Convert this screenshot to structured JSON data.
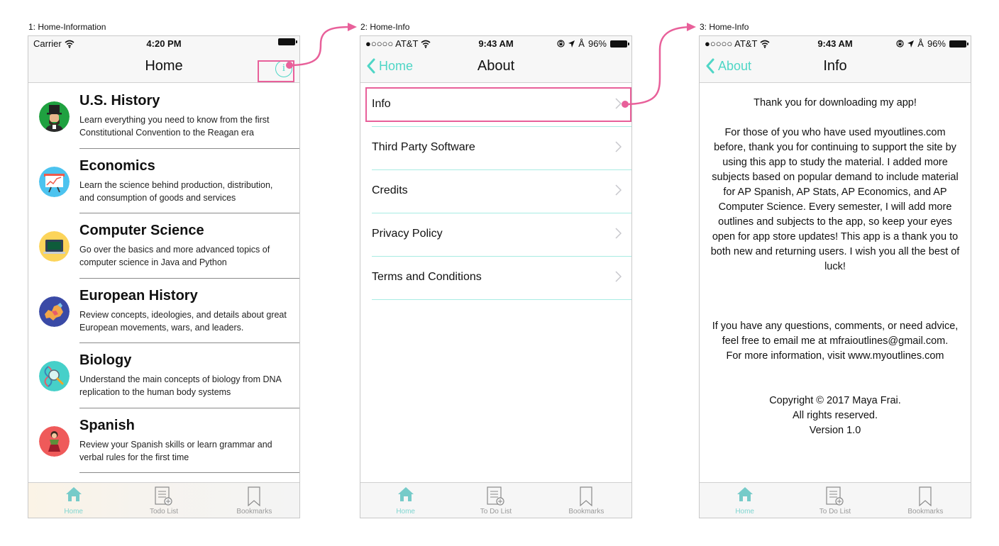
{
  "colors": {
    "accent": "#4fd6c6",
    "highlight": "#e8609a",
    "divider_teal": "#a8ece3",
    "tab_active": "#7fd5d0"
  },
  "screens": [
    {
      "label": "1: Home-Information",
      "status": {
        "carrier": "Carrier",
        "time": "4:20 PM"
      },
      "nav": {
        "title": "Home",
        "info_icon": "info-icon"
      },
      "subjects": [
        {
          "title": "U.S. History",
          "desc": "Learn everything you need to know from the first Constitutional Convention to the Reagan era",
          "icon": "abraham-lincoln-icon",
          "color": "#1fa140"
        },
        {
          "title": "Economics",
          "desc": "Learn the science behind production, distribution, and consumption of goods and services",
          "icon": "presentation-chart-icon",
          "color": "#4cc3ef"
        },
        {
          "title": "Computer Science",
          "desc": "Go over the basics and more advanced topics of computer science in Java and Python",
          "icon": "laptop-icon",
          "color": "#fcd45a"
        },
        {
          "title": "European History",
          "desc": "Review concepts, ideologies, and details about great European movements, wars, and leaders.",
          "icon": "europe-map-icon",
          "color": "#3a4aa6"
        },
        {
          "title": "Biology",
          "desc": "Understand the main concepts of biology from DNA replication to the human body systems",
          "icon": "dna-magnifier-icon",
          "color": "#46d0c9"
        },
        {
          "title": "Spanish",
          "desc": "Review your Spanish skills or learn grammar and verbal rules for the first time",
          "icon": "flamenco-dancer-icon",
          "color": "#ef5a5a"
        }
      ],
      "tabs": [
        {
          "label": "Home",
          "icon": "home-icon",
          "active": true
        },
        {
          "label": "Todo List",
          "icon": "todo-list-icon",
          "active": false
        },
        {
          "label": "Bookmarks",
          "icon": "bookmark-icon",
          "active": false
        }
      ]
    },
    {
      "label": "2: Home-Info",
      "status": {
        "carrier": "●○○○○ AT&T",
        "time": "9:43 AM",
        "battery": "96%"
      },
      "nav": {
        "title": "About",
        "back": "Home"
      },
      "menu": [
        {
          "label": "Info"
        },
        {
          "label": "Third Party Software"
        },
        {
          "label": "Credits"
        },
        {
          "label": "Privacy Policy"
        },
        {
          "label": "Terms and Conditions"
        }
      ],
      "tabs": [
        {
          "label": "Home",
          "icon": "home-icon",
          "active": true
        },
        {
          "label": "To Do List",
          "icon": "todo-list-icon",
          "active": false
        },
        {
          "label": "Bookmarks",
          "icon": "bookmark-icon",
          "active": false
        }
      ]
    },
    {
      "label": "3: Home-Info",
      "status": {
        "carrier": "●○○○○ AT&T",
        "time": "9:43 AM",
        "battery": "96%"
      },
      "nav": {
        "title": "Info",
        "back": "About"
      },
      "info": {
        "thanks": "Thank you for downloading my app!",
        "paragraph": "For those of you who have used myoutlines.com before, thank you for continuing to support the site by using this app to study the material. I added more subjects based on popular demand to include material for AP Spanish, AP Stats, AP Economics, and AP Computer Science. Every semester, I will add more outlines and subjects to the app, so keep your eyes open for app store updates! This app is a thank you to both new and returning users. I wish you all the best of luck!",
        "contact": "If you have any questions, comments, or need advice, feel free to email me at mfraioutlines@gmail.com.",
        "more_info": "For more information, visit www.myoutlines.com",
        "copyright": "Copyright © 2017 Maya Frai.",
        "rights": "All rights reserved.",
        "version": "Version 1.0"
      },
      "tabs": [
        {
          "label": "Home",
          "icon": "home-icon",
          "active": true
        },
        {
          "label": "To Do List",
          "icon": "todo-list-icon",
          "active": false
        },
        {
          "label": "Bookmarks",
          "icon": "bookmark-icon",
          "active": false
        }
      ]
    }
  ]
}
